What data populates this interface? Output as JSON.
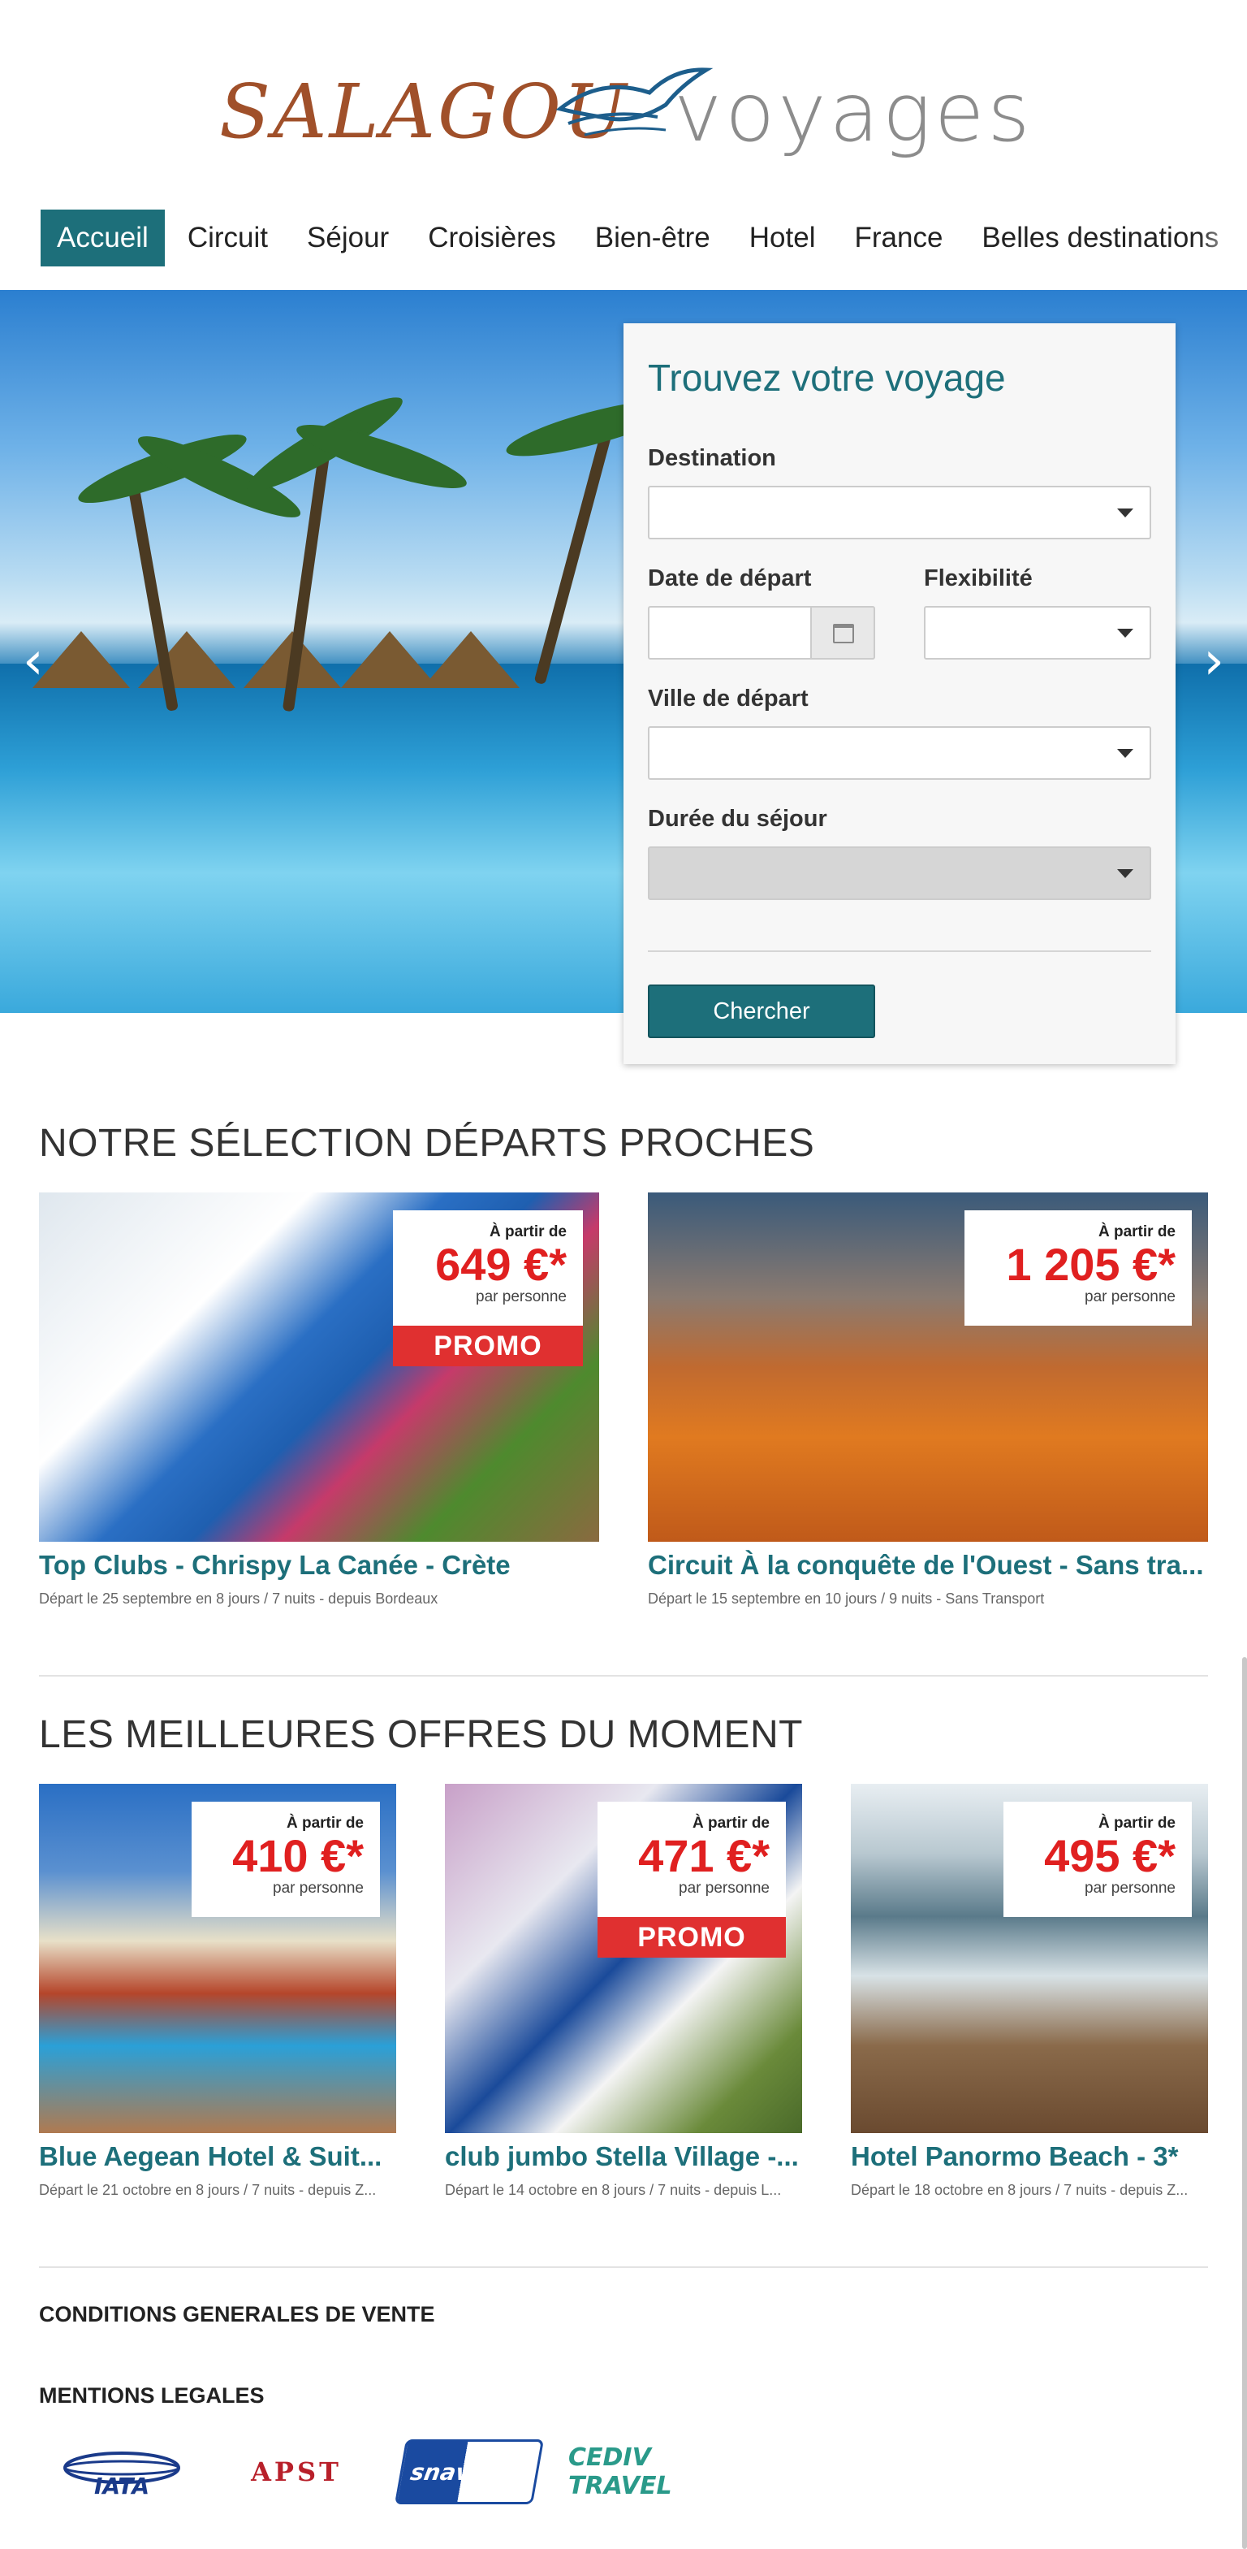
{
  "logo": {
    "left": "SALAGOU",
    "right": "voyages"
  },
  "nav": {
    "items": [
      "Accueil",
      "Circuit",
      "Séjour",
      "Croisières",
      "Bien-être",
      "Hotel",
      "France",
      "Belles destinations"
    ],
    "active": "Accueil"
  },
  "search": {
    "title": "Trouvez votre voyage",
    "destination_label": "Destination",
    "date_label": "Date de départ",
    "flex_label": "Flexibilité",
    "ville_label": "Ville de départ",
    "duree_label": "Durée du séjour",
    "submit_label": "Chercher"
  },
  "section1": {
    "title": "NOTRE SÉLECTION DÉPARTS PROCHES",
    "cards": [
      {
        "from": "À partir de",
        "price": "649 €*",
        "per": "par personne",
        "promo": "PROMO",
        "title": "Top Clubs - Chrispy La Canée - Crète",
        "sub": "Départ le 25 septembre en 8 jours / 7 nuits - depuis Bordeaux"
      },
      {
        "from": "À partir de",
        "price": "1 205 €*",
        "per": "par personne",
        "title": "Circuit À la conquête de l'Ouest - Sans tra...",
        "sub": "Départ le 15 septembre en 10 jours / 9 nuits - Sans Transport"
      }
    ]
  },
  "section2": {
    "title": "LES MEILLEURES OFFRES DU MOMENT",
    "cards": [
      {
        "from": "À partir de",
        "price": "410 €*",
        "per": "par personne",
        "title": "Blue Aegean Hotel & Suit...",
        "sub": "Départ le 21 octobre en 8 jours / 7 nuits - depuis Z..."
      },
      {
        "from": "À partir de",
        "price": "471 €*",
        "per": "par personne",
        "promo": "PROMO",
        "title": "club jumbo Stella Village -...",
        "sub": "Départ le 14 octobre en 8 jours / 7 nuits - depuis L..."
      },
      {
        "from": "À partir de",
        "price": "495 €*",
        "per": "par personne",
        "title": "Hotel Panormo Beach - 3*",
        "sub": "Départ le 18 octobre en 8 jours / 7 nuits - depuis Z..."
      }
    ]
  },
  "footer": {
    "cgv": "CONDITIONS GENERALES DE VENTE",
    "mentions": "MENTIONS LEGALES",
    "partners": [
      "IATA",
      "APST",
      "snav",
      "CEDIV TRAVEL"
    ]
  },
  "colors": {
    "accent": "#1d6f7a",
    "price": "#e02020",
    "promo": "#e03030"
  }
}
